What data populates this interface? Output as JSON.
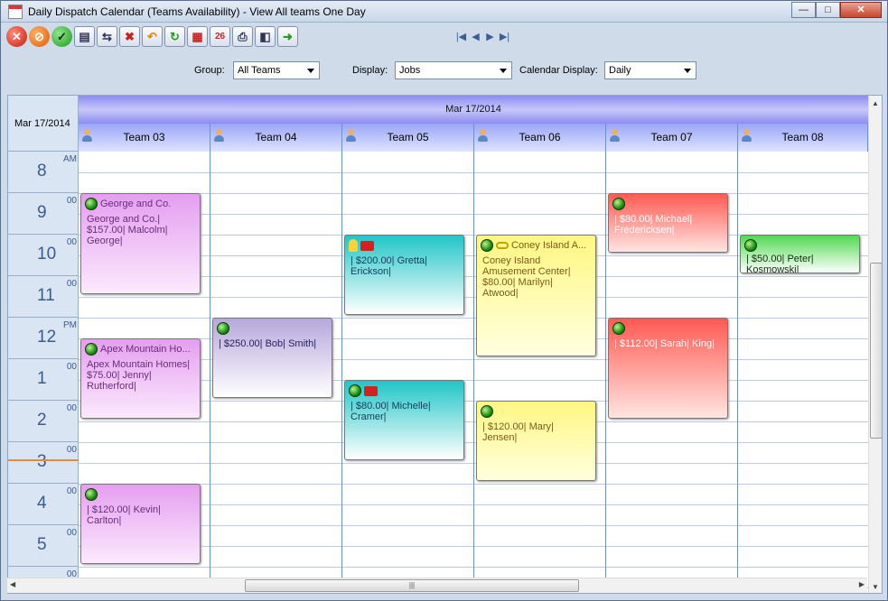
{
  "window": {
    "title": "Daily Dispatch Calendar (Teams Availability) - View All teams One Day",
    "min": "—",
    "max": "□",
    "close": "✕"
  },
  "toolbar": {
    "icons": [
      "cancel-icon",
      "prohibit-icon",
      "ok-icon",
      "report-icon",
      "transfer-icon",
      "delete-calendar-icon",
      "undo-icon",
      "refresh-icon",
      "month-view-icon",
      "day-26-icon",
      "print-icon",
      "export-icon",
      "exit-icon"
    ],
    "day_number": "26"
  },
  "navigation": {
    "first": "|◀",
    "prev": "◀",
    "next": "▶",
    "last": "▶|"
  },
  "filters": {
    "group_label": "Group:",
    "group_value": "All Teams",
    "display_label": "Display:",
    "display_value": "Jobs",
    "calendar_display_label": "Calendar Display:",
    "calendar_display_value": "Daily"
  },
  "calendar": {
    "corner_date": "Mar 17/2014",
    "header_date": "Mar 17/2014",
    "teams": [
      "Team 03",
      "Team 04",
      "Team 05",
      "Team 06",
      "Team 07",
      "Team 08"
    ],
    "hours": [
      {
        "h": "8",
        "m": "AM"
      },
      {
        "h": "9",
        "m": "00"
      },
      {
        "h": "10",
        "m": "00"
      },
      {
        "h": "11",
        "m": "00"
      },
      {
        "h": "12",
        "m": "PM"
      },
      {
        "h": "1",
        "m": "00"
      },
      {
        "h": "2",
        "m": "00"
      },
      {
        "h": "3",
        "m": "00"
      },
      {
        "h": "4",
        "m": "00"
      },
      {
        "h": "5",
        "m": "00"
      },
      {
        "h": "",
        "m": "00"
      }
    ],
    "appointments": [
      {
        "team": "Team 03",
        "title": "George and Co.",
        "body": "George and Co.| $157.00| Malcolm| George|",
        "color": "pink"
      },
      {
        "team": "Team 03",
        "title": "Apex Mountain Ho...",
        "body": "Apex Mountain Homes| $75.00| Jenny| Rutherford|",
        "color": "pink"
      },
      {
        "team": "Team 03",
        "title": "",
        "body": "| $120.00| Kevin| Carlton|",
        "color": "pink"
      },
      {
        "team": "Team 04",
        "title": "",
        "body": "| $250.00| Bob| Smith|",
        "color": "purple"
      },
      {
        "team": "Team 05",
        "title": "",
        "body": "| $200.00| Gretta| Erickson|",
        "color": "cyan"
      },
      {
        "team": "Team 05",
        "title": "",
        "body": "| $80.00| Michelle| Cramer|",
        "color": "cyan"
      },
      {
        "team": "Team 06",
        "title": "Coney Island A...",
        "body": "Coney Island Amusement Center| $80.00| Marilyn| Atwood|",
        "color": "yellow"
      },
      {
        "team": "Team 06",
        "title": "",
        "body": "| $120.00| Mary| Jensen|",
        "color": "yellow"
      },
      {
        "team": "Team 07",
        "title": "",
        "body": "| $80.00| Michael| Fredericksen|",
        "color": "red"
      },
      {
        "team": "Team 07",
        "title": "",
        "body": "| $112.00| Sarah| King|",
        "color": "red"
      },
      {
        "team": "Team 08",
        "title": "",
        "body": "| $50.00| Peter| Kosmowski|",
        "color": "green"
      }
    ]
  },
  "scroll": {
    "up": "▲",
    "down": "▼",
    "left": "◀",
    "right": "▶",
    "grip": "|||"
  }
}
